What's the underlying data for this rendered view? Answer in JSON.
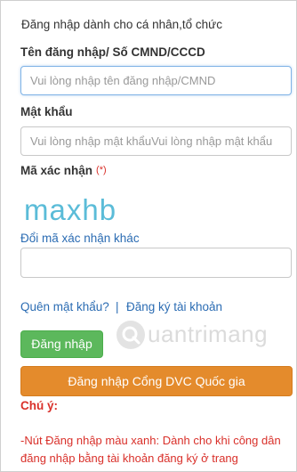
{
  "login": {
    "heading": "Đăng nhập dành cho cá nhân,tổ chức",
    "username_label": "Tên đăng nhập/ Số CMND/CCCD",
    "username_placeholder": "Vui lòng nhập tên đăng nhập/CMND",
    "password_label": "Mật khẩu",
    "password_placeholder": "Vui lòng nhập mật khẩuVui lòng nhập mật khẩu",
    "captcha_label": "Mã xác nhận",
    "required_mark": "(*)",
    "captcha_text": "maxhb",
    "change_captcha_link": "Đổi mã xác nhận khác",
    "captcha_value": "",
    "forgot_password_link": "Quên mật khẩu?",
    "separator": "|",
    "register_link": "Đăng ký tài khoản",
    "login_button": "Đăng nhập",
    "dvc_button": "Đăng nhập Cổng DVC Quốc gia"
  },
  "note": {
    "title": "Chú ý:",
    "text": "-Nút Đăng nhập màu xanh: Dành cho khi công dân đăng nhập bằng tài khoản đăng ký ở trang"
  },
  "watermark": {
    "text": "uantrimang"
  },
  "colors": {
    "link": "#2b6cb3",
    "success_button": "#5cb85c",
    "dvc_button": "#e48b2c",
    "warning_text": "#d9302a",
    "captcha_text": "#5bbcd8"
  }
}
